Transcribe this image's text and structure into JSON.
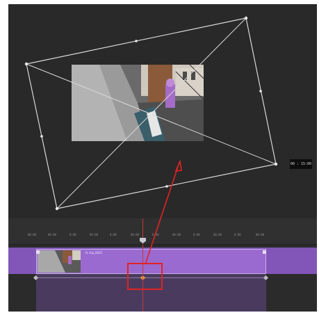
{
  "preview": {
    "timecode": "00 : 15:00"
  },
  "timeline": {
    "ruler_labels": [
      "00:00",
      "00:00",
      "0:00",
      "00:00",
      "0:00",
      "00:00",
      "0:00",
      "00:00",
      "0:00",
      "00:00",
      "0:00",
      "00:00"
    ],
    "clip_title": "fx  clip_0021"
  },
  "annotation": {
    "highlight_color": "#e32222",
    "arrow_color": "#e32222"
  },
  "colors": {
    "panel_bg": "#292929",
    "track_purple": "#8256b8",
    "clip_purple": "#9a6ad0",
    "playhead_red": "#c23a3a",
    "keyframe_orange": "#f2a33a"
  }
}
